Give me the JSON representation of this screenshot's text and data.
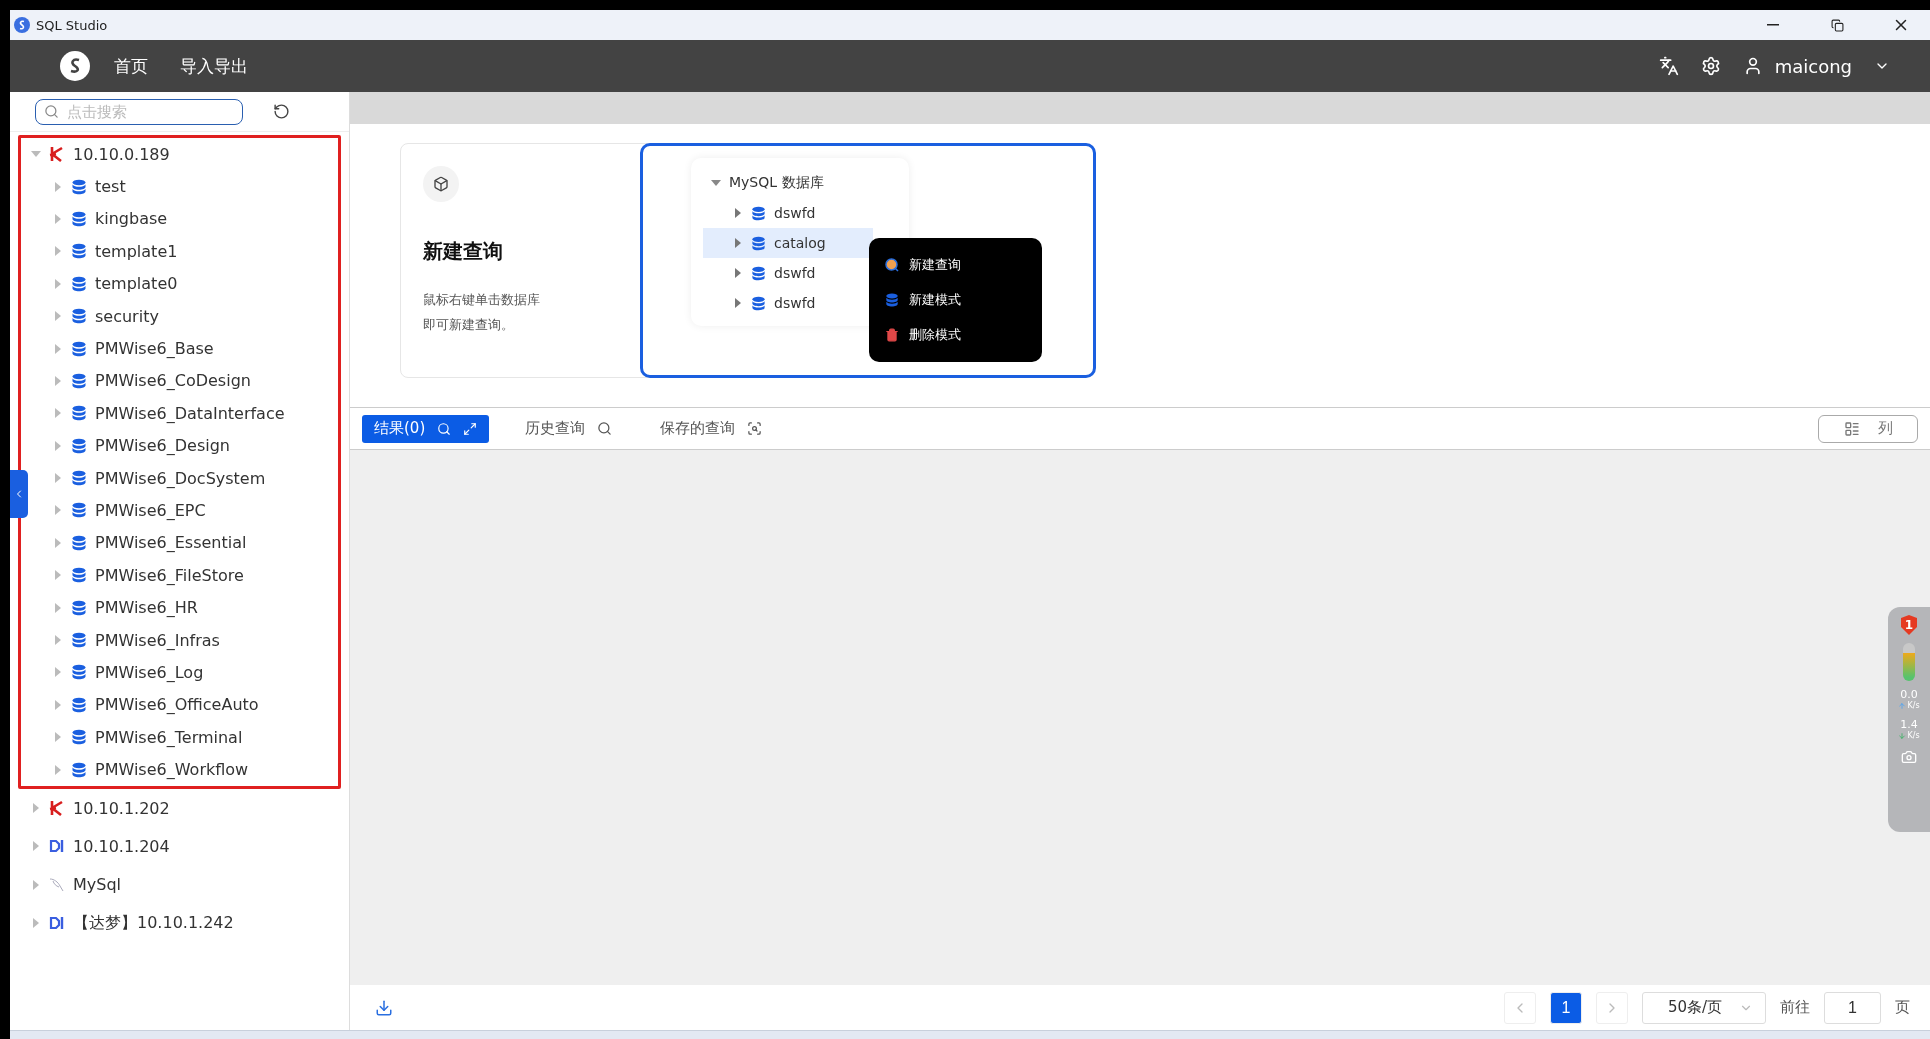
{
  "window": {
    "title": "SQL Studio"
  },
  "header": {
    "nav": [
      {
        "label": "首页"
      },
      {
        "label": "导入导出"
      }
    ],
    "user": "maicong"
  },
  "sidebar": {
    "search": {
      "placeholder": "点击搜索"
    },
    "tree": [
      {
        "label": "10.10.0.189",
        "kind": "kingbase",
        "expanded": true,
        "highlighted": true,
        "children": [
          {
            "label": "test",
            "kind": "database",
            "expanded": false
          },
          {
            "label": "kingbase",
            "kind": "database",
            "expanded": false
          },
          {
            "label": "template1",
            "kind": "database",
            "expanded": false
          },
          {
            "label": "template0",
            "kind": "database",
            "expanded": false
          },
          {
            "label": "security",
            "kind": "database",
            "expanded": false
          },
          {
            "label": "PMWise6_Base",
            "kind": "database",
            "expanded": false
          },
          {
            "label": "PMWise6_CoDesign",
            "kind": "database",
            "expanded": false
          },
          {
            "label": "PMWise6_DataInterface",
            "kind": "database",
            "expanded": false
          },
          {
            "label": "PMWise6_Design",
            "kind": "database",
            "expanded": false
          },
          {
            "label": "PMWise6_DocSystem",
            "kind": "database",
            "expanded": false
          },
          {
            "label": "PMWise6_EPC",
            "kind": "database",
            "expanded": false
          },
          {
            "label": "PMWise6_Essential",
            "kind": "database",
            "expanded": false
          },
          {
            "label": "PMWise6_FileStore",
            "kind": "database",
            "expanded": false
          },
          {
            "label": "PMWise6_HR",
            "kind": "database",
            "expanded": false
          },
          {
            "label": "PMWise6_Infras",
            "kind": "database",
            "expanded": false
          },
          {
            "label": "PMWise6_Log",
            "kind": "database",
            "expanded": false
          },
          {
            "label": "PMWise6_OfficeAuto",
            "kind": "database",
            "expanded": false
          },
          {
            "label": "PMWise6_Terminal",
            "kind": "database",
            "expanded": false
          },
          {
            "label": "PMWise6_Workflow",
            "kind": "database",
            "expanded": false
          }
        ]
      },
      {
        "label": "10.10.1.202",
        "kind": "kingbase",
        "expanded": false,
        "highlighted": false
      },
      {
        "label": "10.10.1.204",
        "kind": "dameng",
        "expanded": false,
        "highlighted": false
      },
      {
        "label": "MySql",
        "kind": "mysql",
        "expanded": false,
        "highlighted": false
      },
      {
        "label": "【达梦】10.10.1.242",
        "kind": "dameng",
        "expanded": false,
        "highlighted": false
      }
    ]
  },
  "guide": {
    "title": "新建查询",
    "description": [
      "鼠标右键单击数据库",
      "即可新建查询。"
    ],
    "illustration": {
      "root": "MySQL 数据库",
      "items": [
        {
          "label": "dswfd",
          "selected": false
        },
        {
          "label": "catalog",
          "selected": true
        },
        {
          "label": "dswfd",
          "selected": false
        },
        {
          "label": "dswfd",
          "selected": false
        }
      ],
      "menu": [
        {
          "label": "新建查询",
          "kind": "query"
        },
        {
          "label": "新建模式",
          "kind": "schema"
        },
        {
          "label": "删除模式",
          "kind": "delete"
        }
      ]
    }
  },
  "results": {
    "tabs": [
      {
        "label": "结果(0)",
        "selected": true
      },
      {
        "label": "历史查询",
        "selected": false
      },
      {
        "label": "保存的查询",
        "selected": false
      }
    ],
    "columns_button": "列"
  },
  "pagination": {
    "pages": [
      {
        "label": "1",
        "selected": true
      }
    ],
    "page_size": "50条/页",
    "goto_label": "前往",
    "goto_value": "1",
    "page_suffix": "页"
  },
  "net_widget": {
    "badge": "1",
    "upload": "0.0",
    "upload_unit": "K/s",
    "download": "1.4",
    "download_unit": "K/s"
  }
}
